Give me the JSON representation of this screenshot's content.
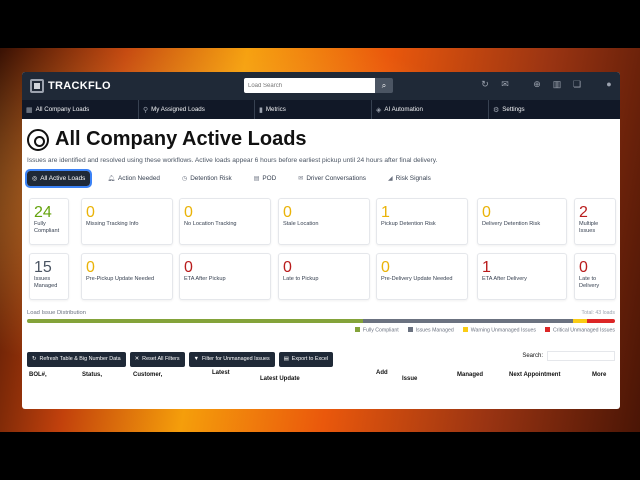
{
  "app": {
    "brand": "TRACKFLO"
  },
  "search": {
    "placeholder": "Load Search"
  },
  "top_icons": [
    "refresh-icon",
    "chat-icon",
    "globe-icon",
    "book-icon",
    "messages-icon",
    "user-icon"
  ],
  "nav": [
    {
      "label": "All Company Loads",
      "icon": "grid-icon"
    },
    {
      "label": "My Assigned Loads",
      "icon": "pin-icon"
    },
    {
      "label": "Metrics",
      "icon": "bars-icon"
    },
    {
      "label": "AI Automation",
      "icon": "robot-icon"
    },
    {
      "label": "Settings",
      "icon": "gear-icon"
    }
  ],
  "page": {
    "title": "All Company Active Loads",
    "subtitle": "Issues are identified and resolved using these workflows. Active loads appear 6 hours before earliest pickup until 24 hours after final delivery."
  },
  "tabs": [
    {
      "label": "All Active Loads",
      "active": true
    },
    {
      "label": "Action Needed"
    },
    {
      "label": "Detention Risk"
    },
    {
      "label": "POD"
    },
    {
      "label": "Driver Conversations"
    },
    {
      "label": "Risk Signals"
    }
  ],
  "cards": [
    {
      "value": "24",
      "label": "Fully Compliant",
      "color": "#65a30d"
    },
    {
      "value": "0",
      "label": "Missing Tracking Info",
      "color": "#eab308"
    },
    {
      "value": "0",
      "label": "No Location Tracking",
      "color": "#eab308"
    },
    {
      "value": "0",
      "label": "Stale Location",
      "color": "#eab308"
    },
    {
      "value": "1",
      "label": "Pickup Detention Risk",
      "color": "#eab308"
    },
    {
      "value": "0",
      "label": "Delivery Detention Risk",
      "color": "#eab308"
    },
    {
      "value": "2",
      "label": "Multiple Issues",
      "color": "#b91c1c"
    },
    {
      "value": "15",
      "label": "Issues Managed",
      "color": "#4b5563"
    },
    {
      "value": "0",
      "label": "Pre-Pickup Update Needed",
      "color": "#eab308"
    },
    {
      "value": "0",
      "label": "ETA After Pickup",
      "color": "#b91c1c"
    },
    {
      "value": "0",
      "label": "Late to Pickup",
      "color": "#b91c1c"
    },
    {
      "value": "0",
      "label": "Pre-Delivery Update Needed",
      "color": "#eab308"
    },
    {
      "value": "1",
      "label": "ETA After Delivery",
      "color": "#b91c1c"
    },
    {
      "value": "0",
      "label": "Late to Delivery",
      "color": "#b91c1c"
    }
  ],
  "distribution": {
    "label": "Load Issue Distribution",
    "total": "Total: 43 loads",
    "segments": [
      {
        "name": "Fully Compliant",
        "count": 24,
        "color": "#84a33a"
      },
      {
        "name": "Issues Managed",
        "count": 15,
        "color": "#6b7280"
      },
      {
        "name": "Warning Unmanaged Issues",
        "count": 1,
        "color": "#facc15"
      },
      {
        "name": "Critical Unmanaged Issues",
        "count": 2,
        "color": "#dc2626"
      }
    ]
  },
  "actions": [
    {
      "label": "Refresh Table & Big Number Data",
      "icon": "refresh-icon"
    },
    {
      "label": "Reset All Filters",
      "icon": "x-icon"
    },
    {
      "label": "Filter for Unmanaged Issues",
      "icon": "filter-icon"
    },
    {
      "label": "Export to Excel",
      "icon": "file-icon"
    }
  ],
  "table": {
    "search_label": "Search:",
    "headers": [
      "BOL#,",
      "Status,",
      "Customer,",
      "Latest",
      "Latest Update",
      "Add",
      "Issue",
      "Managed",
      "Next Appointment",
      "More"
    ]
  }
}
